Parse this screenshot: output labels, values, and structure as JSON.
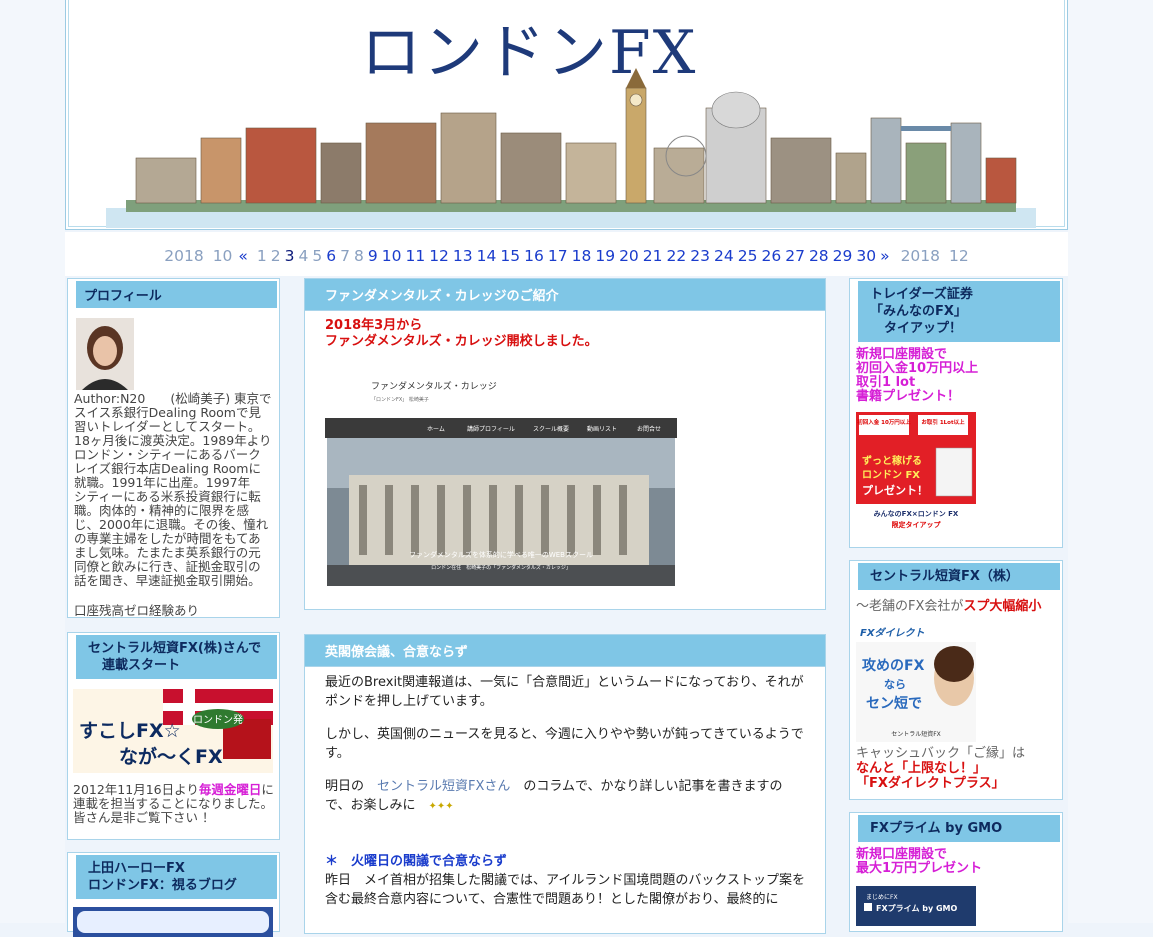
{
  "header": {
    "title": "ロンドンFX"
  },
  "calendar": {
    "prev_year": "2018",
    "prev_month": "10",
    "prev_arrow": "«",
    "days_gray": [
      "1",
      "2"
    ],
    "days_dark": [
      "3"
    ],
    "days_gray2": [
      "4",
      "5"
    ],
    "day6": "6",
    "days_gray3": [
      "7",
      "8"
    ],
    "days_rest": [
      "9",
      "10",
      "11",
      "12",
      "13",
      "14",
      "15",
      "16",
      "17",
      "18",
      "19",
      "20",
      "21",
      "22",
      "23",
      "24",
      "25",
      "26",
      "27",
      "28",
      "29",
      "30"
    ],
    "next_arrow": "»",
    "next_year": "2018",
    "next_month": "12"
  },
  "profile": {
    "title": "プロフィール",
    "text": "Author:N20　　(松崎美子)\n東京でスイス系銀行Dealing Roomで見習いトレイダーとしてスタート。18ヶ月後に渡英決定。1989年よりロンドン・シティーにあるバークレイズ銀行本店Dealing Roomに就職。1991年に出産。1997年　シティーにある米系投資銀行に転職。肉体的・精神的に限界を感じ、2000年に退職。その後、憧れの専業主婦をしたが時間をもてあまし気味。たまたま英系銀行の元同僚と飲みに行き、証拠金取引の話を聞き、早速証拠金取引開始。",
    "footer": "口座残高ゼロ経験あり"
  },
  "central1": {
    "title_line1": "セントラル短資FX(株)さんで",
    "title_line2": "連載スタート",
    "banner_text1": "すこしFX☆",
    "banner_text2": "なが～くFX",
    "banner_badge": "ロンドン発",
    "text_before": "2012年11月16日より",
    "text_highlight": "毎週金曜日",
    "text_after": "に連載を担当することになりました。 皆さん是非ご覧下さい ！"
  },
  "ueda": {
    "title_line1": "上田ハーローFX",
    "title_line2": "ロンドンFX：視るブログ"
  },
  "intro": {
    "title": "ファンダメンタルズ・カレッジのご紹介",
    "line1": "2018年3月から",
    "line2": "ファンダメンタルズ・カレッジ開校しました。",
    "shot": {
      "site_title": "ファンダメンタルズ・カレッジ",
      "site_sub": "「ロンドンFX」 松崎美子",
      "menu": [
        "ホーム",
        "講師プロフィール",
        "スクール概要",
        "動画リスト",
        "お問合せ"
      ],
      "caption": "ファンダメンタルズを体系的に学べる唯一のWEBスクール",
      "caption2": "ロンドン在住　松崎美子の「ファンダメンタルズ・カレッジ」"
    }
  },
  "article": {
    "title": "英閣僚会議、合意ならず",
    "p1": "最近のBrexit関連報道は、一気に「合意間近」というムードになっており、それがポンドを押し上げています。",
    "p2": "しかし、英国側のニュースを見ると、今週に入りやや勢いが鈍ってきているようです。",
    "p3_a": "明日の　",
    "p3_link": "セントラル短資FXさん",
    "p3_b": "　のコラムで、かなり詳しい記事を書きますので、お楽しみに　",
    "p3_sparkle": "✦✦✦",
    "section": "＊　火曜日の閣議で合意ならず",
    "p4": "昨日　メイ首相が招集した閣議では、アイルランド国境問題のバックストップ案を含む最終合意内容について、合憲性で問題あり！とした閣僚がおり、最終的に"
  },
  "traders": {
    "title_line1": "トレイダーズ証券",
    "title_line2": "「みんなのFX」",
    "title_line3": "タイアップ！",
    "promo": [
      "新規口座開設で",
      "初回入金10万円以上",
      "取引1 lot",
      "書籍プレゼント！"
    ],
    "banner": {
      "left_top": "初回入金\n10万円以上",
      "right_top": "お取引\n1Lot以上",
      "mid1": "ずっと稼げる",
      "mid2": "ロンドン FX",
      "mid3": "プレゼント！",
      "bottom1": "みんなのFX×ロンドン FX",
      "bottom2": "限定タイアップ"
    }
  },
  "central2": {
    "title": "セントラル短資FX（株）",
    "tag_before": "～老舗のFX会社が",
    "tag_red": "スプ大幅縮小",
    "banner": {
      "brand": "FXダイレクト",
      "l1": "攻めのFX",
      "l2": "なら",
      "l3": "セン短で",
      "foot": "セントラル短資FX"
    },
    "text1": "キャッシュバック「ご縁」は",
    "text2": "なんと「上限なし！」",
    "text3": "「FXダイレクトプラス」"
  },
  "fxprime": {
    "title": "FXプライム by GMO",
    "promo1": "新規口座開設で",
    "promo2": "最大1万円プレゼント",
    "banner_small": "まじめにFX",
    "banner_main": "FXプライム by GMO"
  }
}
